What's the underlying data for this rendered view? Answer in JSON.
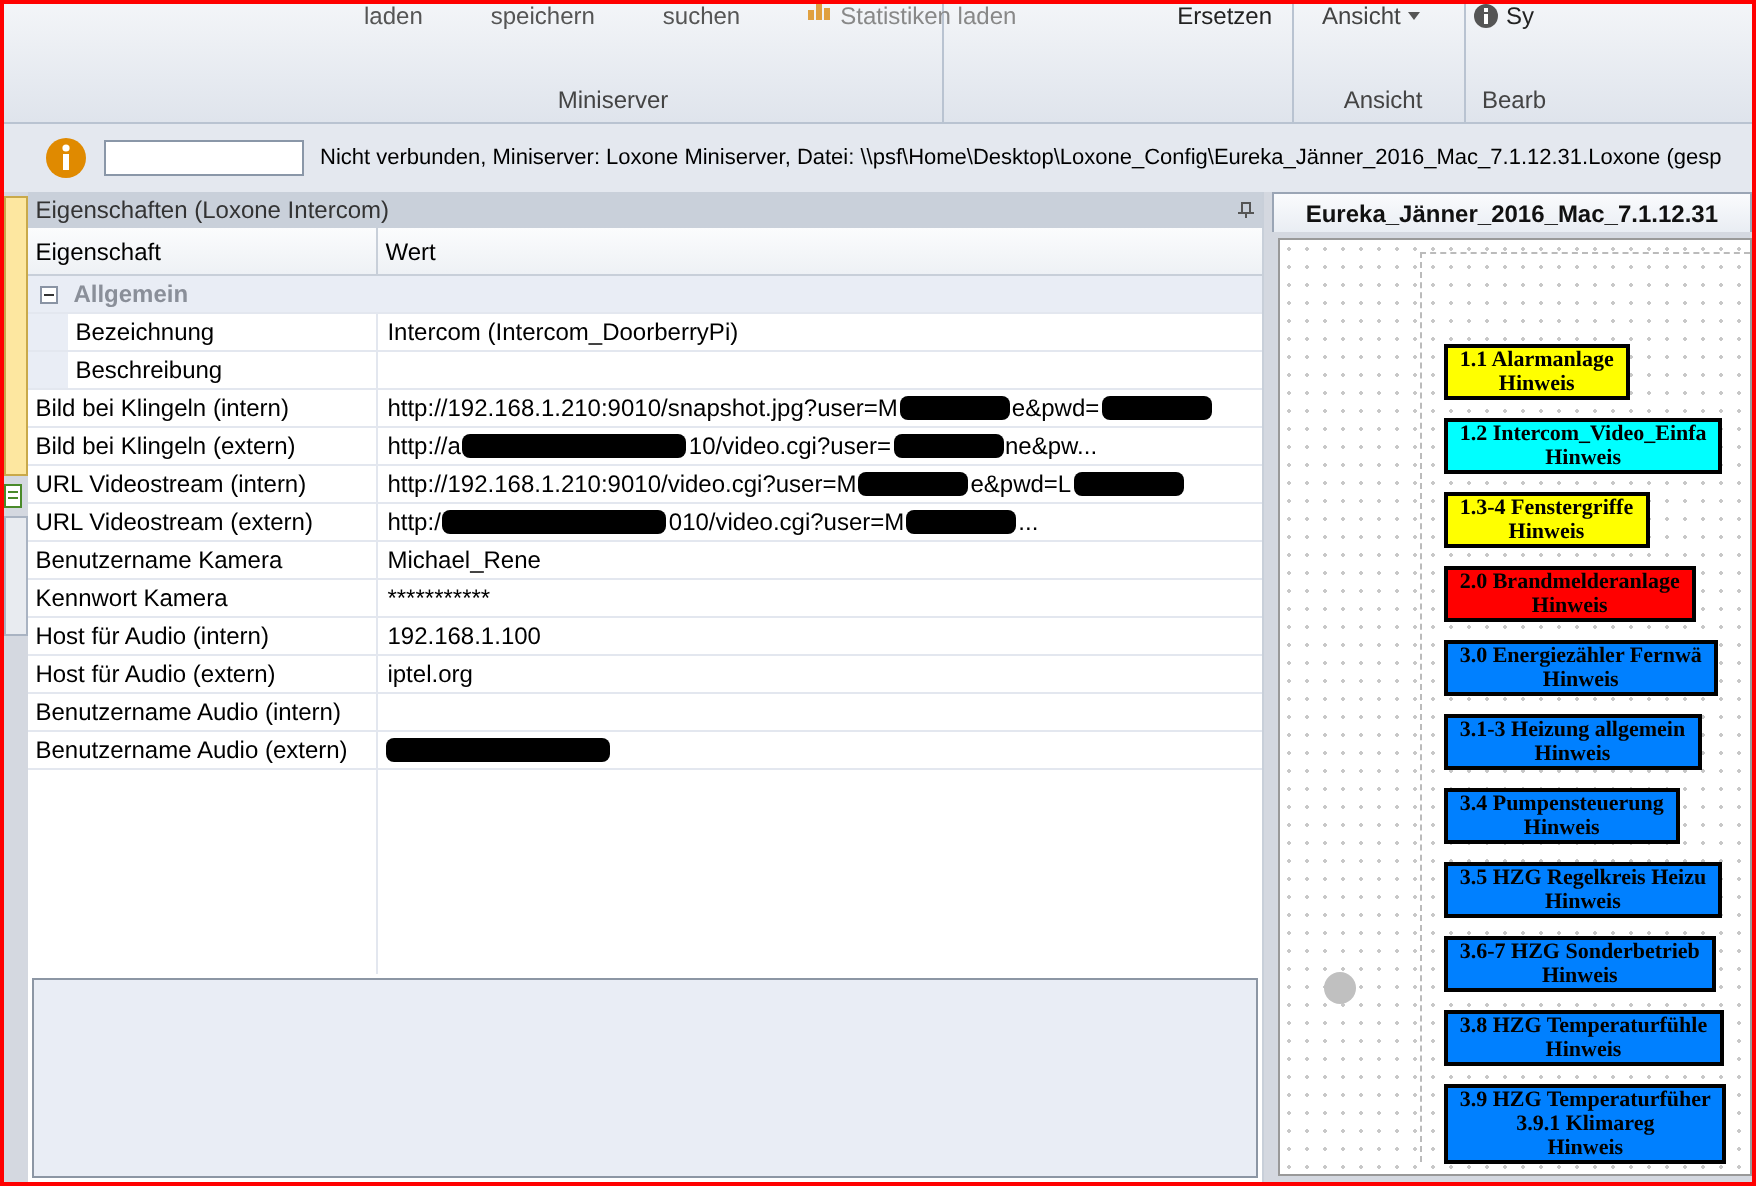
{
  "ribbon": {
    "buttons": [
      {
        "label": "laden"
      },
      {
        "label": "speichern"
      },
      {
        "label": "suchen"
      }
    ],
    "stats_button": {
      "label": "Statistiken laden"
    },
    "groups": [
      {
        "label": "Miniserver"
      },
      {
        "label": "Ansicht"
      },
      {
        "label": "Bearb"
      }
    ],
    "replace_button": {
      "label": "Ersetzen"
    },
    "view_dropdown": {
      "label": "Ansicht"
    },
    "cut_button": {
      "label": "Sy"
    }
  },
  "info_bar": {
    "message": "Nicht verbunden, Miniserver: Loxone Miniserver, Datei: \\\\psf\\Home\\Desktop\\Loxone_Config\\Eureka_Jänner_2016_Mac_7.1.12.31.Loxone (gesp"
  },
  "properties": {
    "title": "Eigenschaften (Loxone Intercom)",
    "columns": [
      "Eigenschaft",
      "Wert"
    ],
    "group": {
      "label": "Allgemein",
      "expanded": true,
      "rows": [
        {
          "name": "Bezeichnung",
          "value": [
            {
              "kind": "text",
              "text": "Intercom (Intercom_DoorberryPi)"
            }
          ]
        },
        {
          "name": "Beschreibung",
          "value": []
        }
      ]
    },
    "rows": [
      {
        "name": "Bild bei Klingeln (intern)",
        "value": [
          {
            "kind": "text",
            "text": "http://192.168.1.210:9010/snapshot.jpg?user=M"
          },
          {
            "kind": "redacted"
          },
          {
            "kind": "text",
            "text": "e&pwd="
          },
          {
            "kind": "redacted"
          }
        ]
      },
      {
        "name": "Bild bei Klingeln (extern)",
        "value": [
          {
            "kind": "text",
            "text": "http://a"
          },
          {
            "kind": "redacted_long"
          },
          {
            "kind": "text",
            "text": "10/video.cgi?user="
          },
          {
            "kind": "redacted"
          },
          {
            "kind": "text",
            "text": "ne&pw..."
          }
        ]
      },
      {
        "name": "URL Videostream (intern)",
        "value": [
          {
            "kind": "text",
            "text": "http://192.168.1.210:9010/video.cgi?user=M"
          },
          {
            "kind": "redacted"
          },
          {
            "kind": "text",
            "text": "e&pwd=L"
          },
          {
            "kind": "redacted"
          }
        ]
      },
      {
        "name": "URL Videostream (extern)",
        "value": [
          {
            "kind": "text",
            "text": "http:/"
          },
          {
            "kind": "redacted_long"
          },
          {
            "kind": "text",
            "text": "010/video.cgi?user=M"
          },
          {
            "kind": "redacted"
          },
          {
            "kind": "text",
            "text": "..."
          }
        ]
      },
      {
        "name": "Benutzername Kamera",
        "value": [
          {
            "kind": "text",
            "text": "Michael_Rene"
          }
        ]
      },
      {
        "name": "Kennwort Kamera",
        "value": [
          {
            "kind": "text",
            "text": "***********"
          }
        ]
      },
      {
        "name": "Host für Audio (intern)",
        "value": [
          {
            "kind": "text",
            "text": "192.168.1.100"
          }
        ]
      },
      {
        "name": "Host für Audio (extern)",
        "value": [
          {
            "kind": "text",
            "text": "iptel.org"
          }
        ]
      },
      {
        "name": "Benutzername Audio (intern)",
        "value": []
      },
      {
        "name": "Benutzername Audio (extern)",
        "value": [
          {
            "kind": "redacted_long"
          }
        ]
      }
    ]
  },
  "document": {
    "tab": "Eureka_Jänner_2016_Mac_7.1.12.31",
    "blocks": [
      {
        "lines": [
          "1.1 Alarmanlage",
          "Hinweis"
        ],
        "color": "#ffff00"
      },
      {
        "lines": [
          "1.2 Intercom_Video_Einfa",
          "Hinweis"
        ],
        "color": "#00ffff"
      },
      {
        "lines": [
          "1.3-4 Fenstergriffe",
          "Hinweis"
        ],
        "color": "#ffff00"
      },
      {
        "lines": [
          "2.0 Brandmelderanlage",
          "Hinweis"
        ],
        "color": "#ff0000"
      },
      {
        "lines": [
          "3.0 Energiezähler Fernwä",
          "Hinweis"
        ],
        "color": "#0080ff"
      },
      {
        "lines": [
          "3.1-3 Heizung allgemein",
          "Hinweis"
        ],
        "color": "#0080ff"
      },
      {
        "lines": [
          "3.4 Pumpensteuerung",
          "Hinweis"
        ],
        "color": "#0080ff"
      },
      {
        "lines": [
          "3.5 HZG Regelkreis Heizu",
          "Hinweis"
        ],
        "color": "#0080ff"
      },
      {
        "lines": [
          "3.6-7 HZG Sonderbetrieb",
          "Hinweis"
        ],
        "color": "#0080ff"
      },
      {
        "lines": [
          "3.8 HZG Temperaturfühle",
          "Hinweis"
        ],
        "color": "#0080ff"
      },
      {
        "lines": [
          "3.9 HZG Temperaturfüher",
          "3.9.1 Klimareg",
          "Hinweis"
        ],
        "color": "#0080ff"
      }
    ]
  }
}
